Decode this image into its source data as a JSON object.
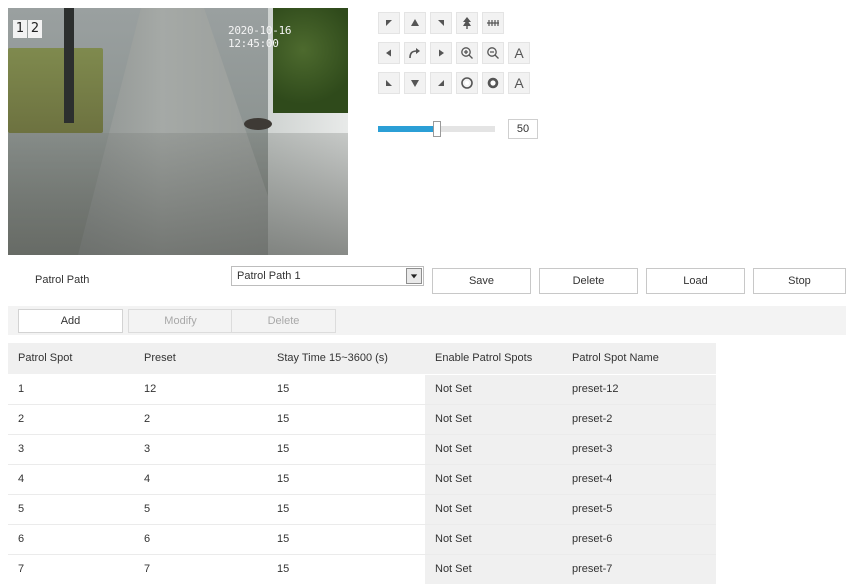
{
  "video": {
    "channel_buttons": [
      "1",
      "2"
    ],
    "timestamp": "2020-10-16 12:45:00"
  },
  "ptz": {
    "buttons": [
      "pan-up-left-icon",
      "pan-up-icon",
      "pan-up-right-icon",
      "wiper-icon",
      "focus-icon",
      "pan-left-icon",
      "auto-scan-icon",
      "pan-right-icon",
      "zoom-in-icon",
      "zoom-out-icon",
      "auto-focus-icon",
      "pan-down-left-icon",
      "pan-down-icon",
      "pan-down-right-icon",
      "iris-open-icon",
      "iris-close-icon",
      "auto-iris-icon"
    ],
    "auto_label": "A",
    "speed_value": "50",
    "speed_fraction": 0.5
  },
  "patrol": {
    "path_label": "Patrol Path",
    "path_selected": "Patrol Path 1",
    "save_label": "Save",
    "delete_label": "Delete",
    "load_label": "Load",
    "stop_label": "Stop"
  },
  "toolbar": {
    "add_label": "Add",
    "modify_label": "Modify",
    "delete_label": "Delete"
  },
  "table": {
    "headers": [
      "Patrol Spot",
      "Preset",
      "Stay Time 15~3600 (s)",
      "Enable Patrol Spots",
      "Patrol Spot Name"
    ],
    "rows": [
      [
        "1",
        "12",
        "15",
        "Not Set",
        "preset-12"
      ],
      [
        "2",
        "2",
        "15",
        "Not Set",
        "preset-2"
      ],
      [
        "3",
        "3",
        "15",
        "Not Set",
        "preset-3"
      ],
      [
        "4",
        "4",
        "15",
        "Not Set",
        "preset-4"
      ],
      [
        "5",
        "5",
        "15",
        "Not Set",
        "preset-5"
      ],
      [
        "6",
        "6",
        "15",
        "Not Set",
        "preset-6"
      ],
      [
        "7",
        "7",
        "15",
        "Not Set",
        "preset-7"
      ]
    ]
  },
  "colors": {
    "accent": "#2b9fd6",
    "header_bg": "#f0f0f0",
    "toolbar_bg": "#f3f3f3"
  }
}
